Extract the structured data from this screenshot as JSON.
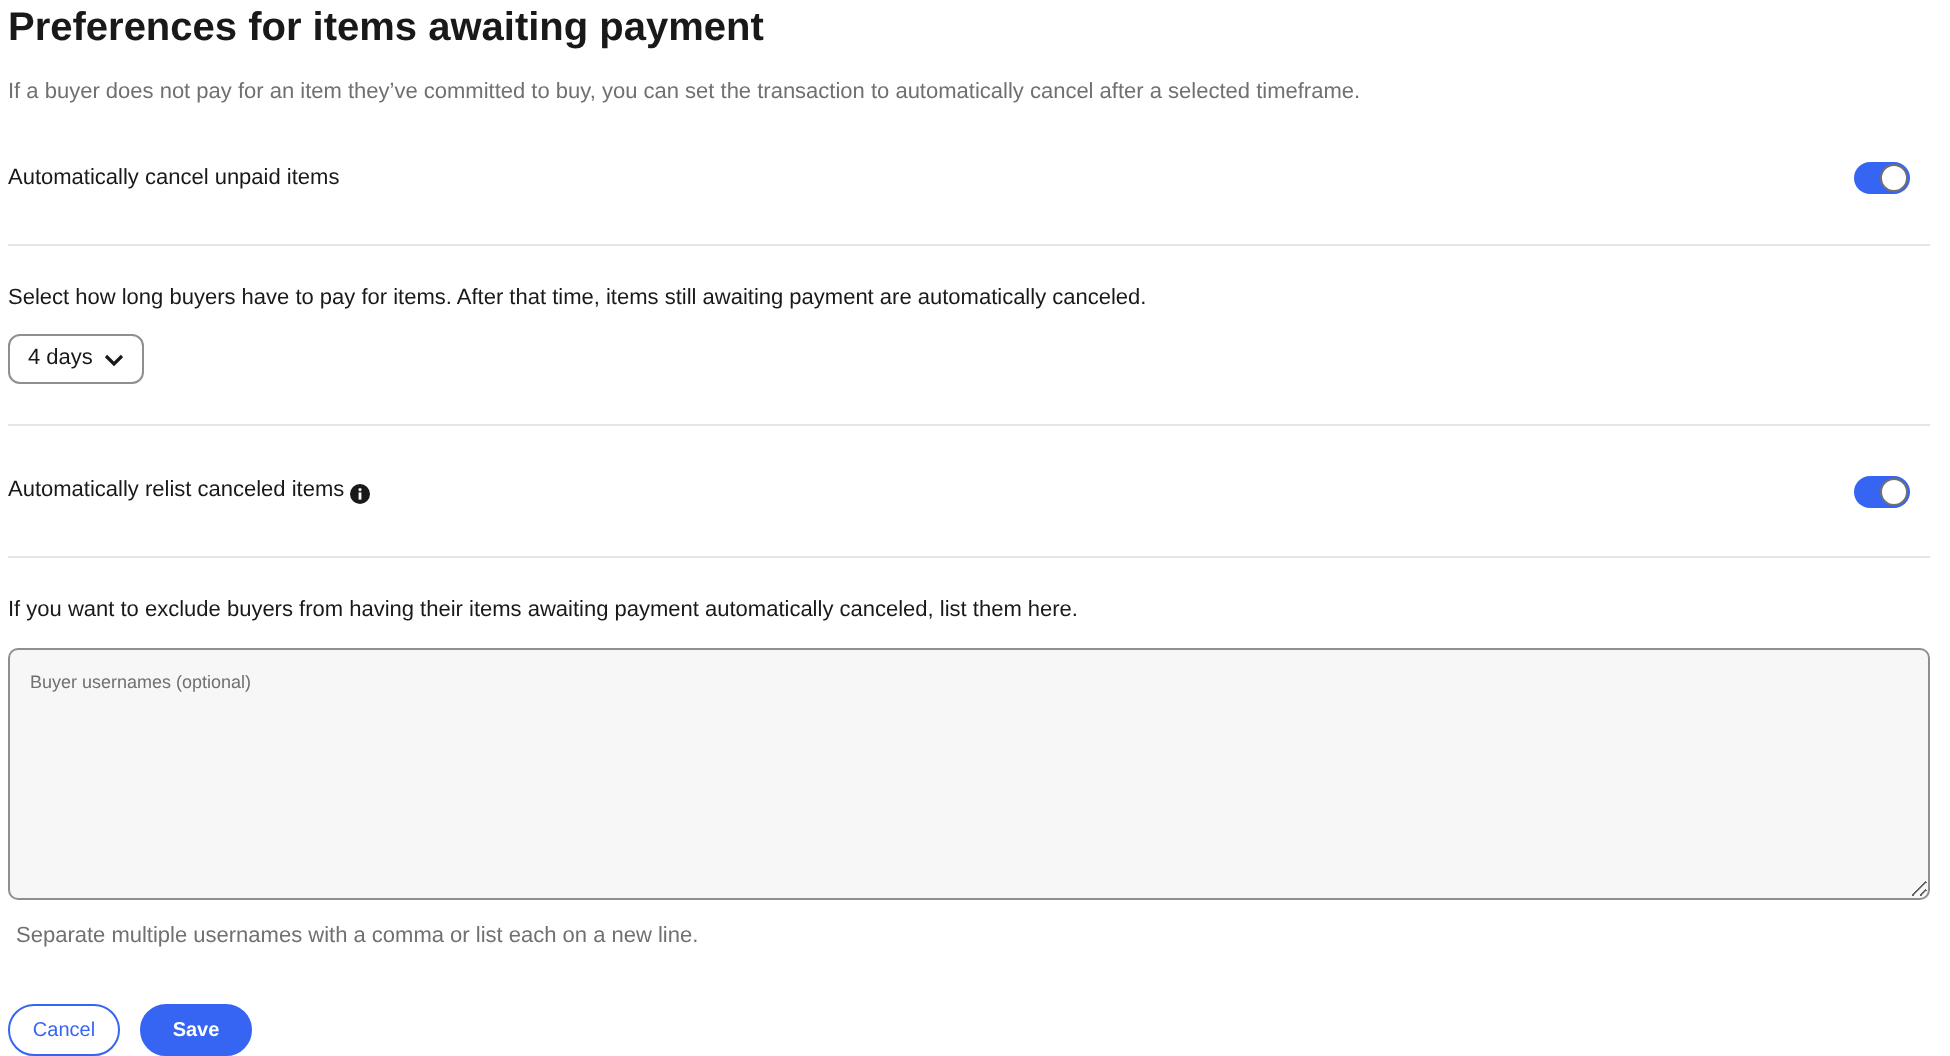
{
  "title": "Preferences for items awaiting payment",
  "description": "If a buyer does not pay for an item they’ve committed to buy, you can set the transaction to automatically cancel after a selected timeframe.",
  "auto_cancel": {
    "label": "Automatically cancel unpaid items",
    "on": true
  },
  "timeframe": {
    "text": "Select how long buyers have to pay for items. After that time, items still awaiting payment are automatically canceled.",
    "value": "4 days"
  },
  "auto_relist": {
    "label": "Automatically relist canceled items",
    "on": true,
    "info": true
  },
  "exclude": {
    "text": "If you want to exclude buyers from having their items awaiting payment automatically canceled, list them here.",
    "placeholder": "Buyer usernames (optional)",
    "help": "Separate multiple usernames with a comma or list each on a new line."
  },
  "buttons": [
    {
      "label": "Cancel",
      "kind": "secondary"
    },
    {
      "label": "Save",
      "kind": "primary"
    }
  ]
}
